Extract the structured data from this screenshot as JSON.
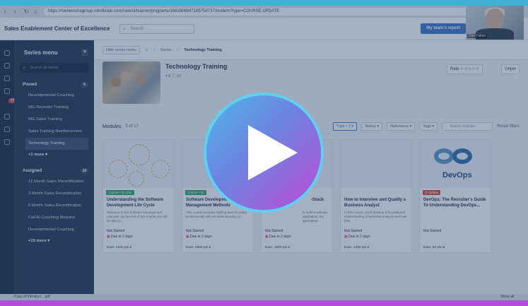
{
  "browser": {
    "url": "https://menemshagroup.mindtickle.com/new/ui/learner/programs/1683906847185758737/modern?type=COURSE,UPDATE"
  },
  "app": {
    "title": "Sales Enablement Center of Excellence",
    "search_placeholder": "Search",
    "team_button": "My team's report",
    "cam_name": "Dan Fisher"
  },
  "series_menu": {
    "title": "Series menu",
    "search_placeholder": "Search all series",
    "pinned_label": "Pinned",
    "pinned_count": "6",
    "pinned": [
      "Developmental Coaching",
      "MG Recruiter Training",
      "MG Sales Training",
      "Sales Training Reinforcement",
      "Technology Training"
    ],
    "pinned_more": "+1 more ▾",
    "assigned_label": "Assigned",
    "assigned_count": "20",
    "assigned": [
      "12 Month Sales Recertification",
      "3 Month Sales Recertification",
      "6 Month Sales Recertification",
      "Call AI Coaching Modules",
      "Developmental Coaching"
    ],
    "assigned_more": "+15 more ▾"
  },
  "rail": {
    "badge": "13"
  },
  "crumbs": {
    "hide": "Hide series menu",
    "series": "Series",
    "current": "Technology Training"
  },
  "hero": {
    "title": "Technology Training",
    "meta": "▾ 8 ⓘ 10",
    "rate": "Rate ☆☆☆☆☆",
    "unpin": "Unpin"
  },
  "modules": {
    "label": "Modules",
    "count": "5 of 17",
    "filters": [
      "Type • 2 ▾",
      "Status ▾",
      "Relevance ▾",
      "Tags ▾"
    ],
    "search_placeholder": "Search modules",
    "reset": "Reset filters"
  },
  "cards": [
    {
      "tag": "Course • 1h 30m",
      "tag_color": "#2fa86a",
      "title": "Understanding the Software Development Life Cycle",
      "desc": "Welcome to the Software Development Lifecycle. By the end of this course you will be able to...",
      "status": "Not Started",
      "due": "Due in 2 days",
      "earn": "Earn: 4100 pts"
    },
    {
      "tag": "Course • 1h",
      "tag_color": "#2fa86a",
      "title": "Software Development Management Methods",
      "desc": "This course provides staffing and recruiting professionals with an understanding of...",
      "status": "Not Started",
      "due": "Due in 2 days",
      "earn": "Earn: 2950 pts"
    },
    {
      "tag": "",
      "tag_color": "#2fa86a",
      "title": "-Stack",
      "desc": "to build a website, application, the application",
      "status": "Not Started",
      "due": "Due in 2 days",
      "earn": "Earn: 1050 pts"
    },
    {
      "tag": "",
      "tag_color": "#2fa86a",
      "title": "How to Interview and Qualify a Business Analyst",
      "desc": "In this course, you'll develop a foundational understanding of business analysis and how they...",
      "status": "Not Started",
      "due": "Due in 2 days",
      "earn": "Earn: 1250 pts"
    },
    {
      "tag": "Q Update",
      "tag_color": "#e0453a",
      "title": "DevOps: The Recruiter's Guide To Understanding DevOps...",
      "desc": "",
      "status": "Not Started",
      "due": "",
      "earn": "Earn: 50 pts",
      "logo": "DevOps"
    }
  ],
  "footer": {
    "download": "Copy of Introduct....pdf",
    "show_all": "Show all"
  },
  "colors": {
    "accent": "#3f74c5",
    "sidebar": "#253650",
    "play_gradient_start": "#4fb6e8",
    "play_gradient_end": "#c04ad8"
  }
}
